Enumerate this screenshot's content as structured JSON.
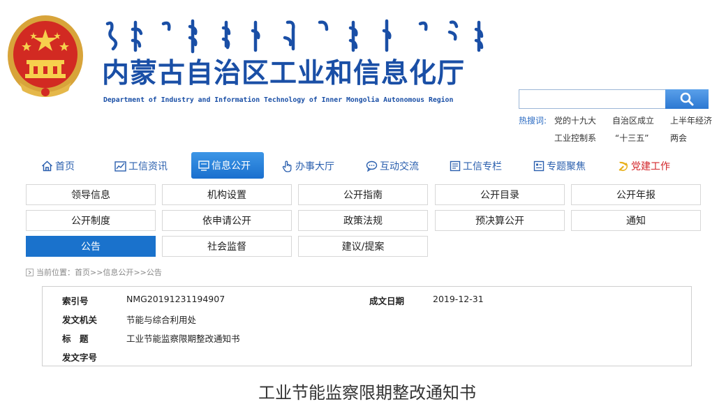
{
  "header": {
    "title_cn": "内蒙古自治区工业和信息化厅",
    "title_en": "Department of Industry and Information Technology of Inner Mongolia Autonomous Region"
  },
  "search": {
    "value": "",
    "hot_label": "热搜词:",
    "keywords": [
      "党的十九大",
      "自治区成立",
      "上半年经济",
      "工业控制系",
      "“十三五”",
      "两会"
    ]
  },
  "nav": [
    {
      "label": "首页",
      "icon": "home-icon"
    },
    {
      "label": "工信资讯",
      "icon": "chart-icon"
    },
    {
      "label": "信息公开",
      "icon": "monitor-icon",
      "active": true
    },
    {
      "label": "办事大厅",
      "icon": "hand-pointer-icon"
    },
    {
      "label": "互动交流",
      "icon": "chat-icon"
    },
    {
      "label": "工信专栏",
      "icon": "document-icon"
    },
    {
      "label": "专题聚焦",
      "icon": "list-icon"
    },
    {
      "label": "党建工作",
      "icon": "party-emblem-icon"
    }
  ],
  "subnav": [
    [
      "领导信息",
      "机构设置",
      "公开指南",
      "公开目录",
      "公开年报"
    ],
    [
      "公开制度",
      "依申请公开",
      "政策法规",
      "预决算公开",
      "通知"
    ],
    [
      "公告",
      "社会监督",
      "建议/提案"
    ]
  ],
  "breadcrumb": {
    "label": "当前位置：",
    "items": [
      "首页",
      "信息公开",
      "公告"
    ],
    "separator": ">>"
  },
  "info": {
    "index_label": "索引号",
    "index_value": "NMG20191231194907",
    "date_label": "成文日期",
    "date_value": "2019-12-31",
    "issuer_label": "发文机关",
    "issuer_value": "节能与综合利用处",
    "subject_label": "标　题",
    "subject_value": "工业节能监察限期整改通知书",
    "docno_label": "发文字号",
    "docno_value": ""
  },
  "article": {
    "title": "工业节能监察限期整改通知书"
  },
  "colors": {
    "primary_blue": "#1a72cc",
    "title_blue": "#1a4fa6",
    "party_red": "#d3262b"
  }
}
